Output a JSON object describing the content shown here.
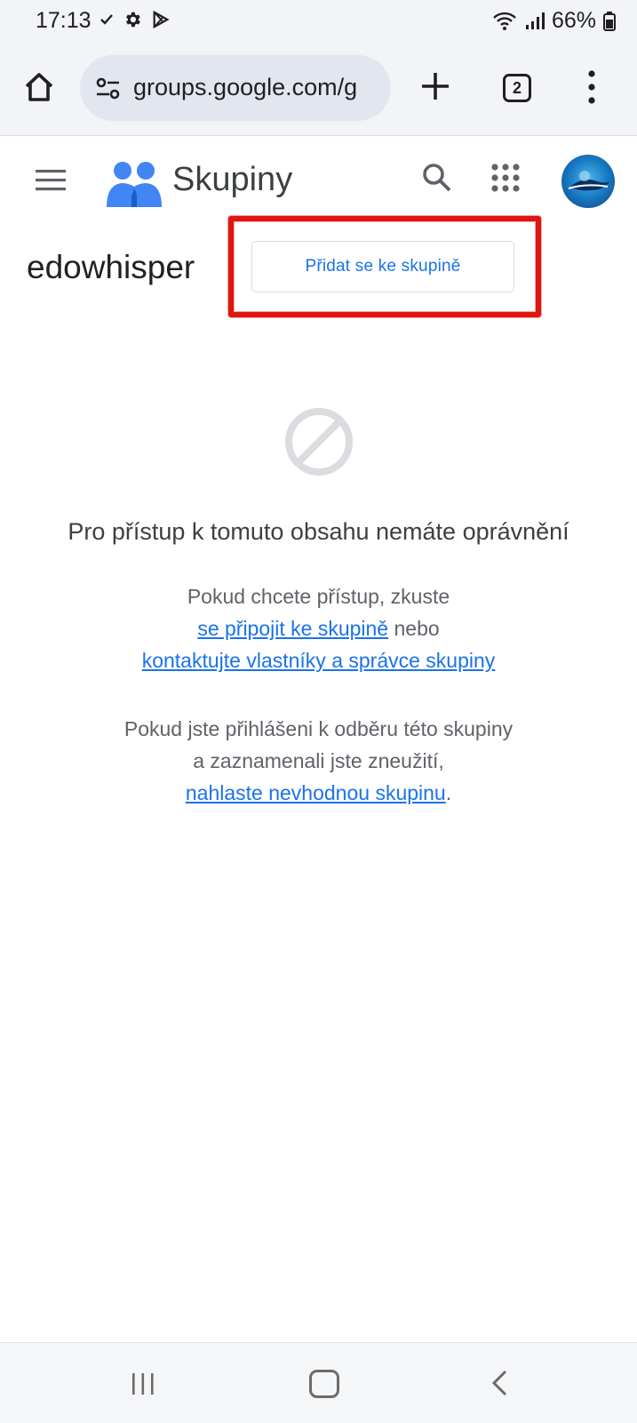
{
  "status_bar": {
    "time": "17:13",
    "battery": "66%",
    "left_icons": [
      "check-icon",
      "gear-icon",
      "play-store-icon"
    ],
    "right_icons": [
      "wifi-icon",
      "signal-icon",
      "battery-icon"
    ]
  },
  "browser": {
    "url": "groups.google.com/g",
    "tab_count": "2"
  },
  "app": {
    "title": "Skupiny"
  },
  "group": {
    "name": "edowhisper",
    "join_label": "Přidat se ke skupině"
  },
  "content": {
    "heading": "Pro přístup k tomuto obsahu nemáte oprávnění",
    "p1_line1": "Pokud chcete přístup, zkuste",
    "p1_link1": "se připojit ke skupině",
    "p1_mid": " nebo",
    "p1_link2": "kontaktujte vlastníky a správce skupiny",
    "p2_line1": "Pokud jste přihlášeni k odběru této skupiny",
    "p2_line2": "a zaznamenali jste zneužití,",
    "p2_link": "nahlaste nevhodnou skupinu",
    "p2_end": "."
  },
  "colors": {
    "accent": "#1a73e8",
    "highlight": "#e0150f",
    "logo_blue": "#4285f4"
  }
}
